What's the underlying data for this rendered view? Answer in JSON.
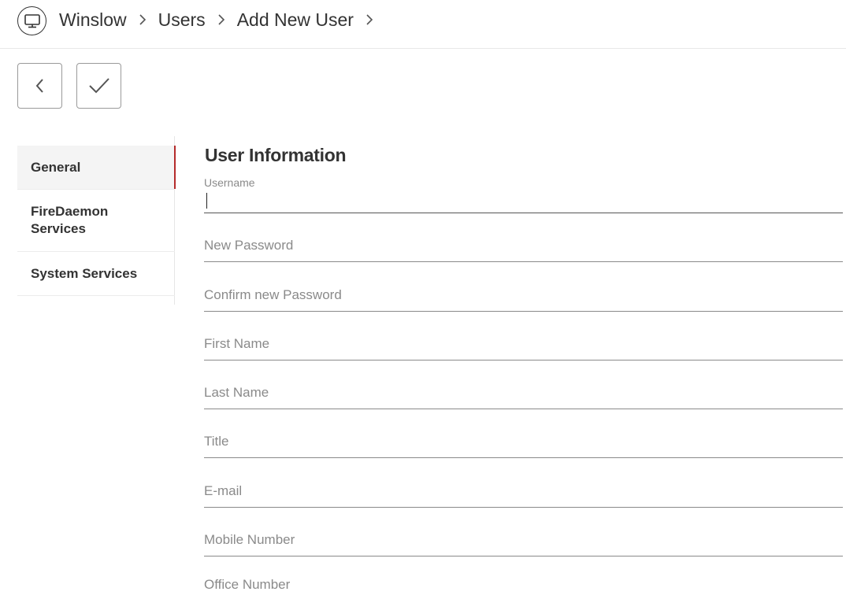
{
  "header": {
    "app_icon": "monitor-icon",
    "breadcrumbs": [
      "Winslow",
      "Users",
      "Add New User"
    ],
    "chevron_icon": "chevron-right-icon"
  },
  "toolbar": {
    "back_icon": "chevron-left-icon",
    "save_icon": "checkmark-icon"
  },
  "sidenav": {
    "items": [
      {
        "label": "General",
        "active": true
      },
      {
        "label": "FireDaemon Services",
        "active": false
      },
      {
        "label": "System Services",
        "active": false
      }
    ],
    "active_color": "#b52b2b"
  },
  "form": {
    "title": "User Information",
    "username": {
      "label": "Username",
      "value": ""
    },
    "new_password": {
      "placeholder": "New Password"
    },
    "confirm_password": {
      "placeholder": "Confirm new Password"
    },
    "first_name": {
      "placeholder": "First Name"
    },
    "last_name": {
      "placeholder": "Last Name"
    },
    "title_field": {
      "placeholder": "Title"
    },
    "email": {
      "placeholder": "E-mail"
    },
    "mobile": {
      "placeholder": "Mobile Number"
    },
    "office": {
      "placeholder": "Office Number"
    }
  }
}
